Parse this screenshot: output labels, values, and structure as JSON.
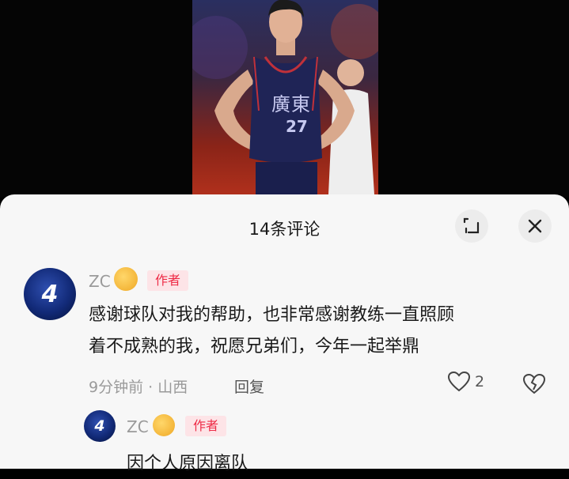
{
  "comments_panel": {
    "title": "14条评论",
    "expand_icon": "expand-icon",
    "close_icon": "close-icon"
  },
  "photo": {
    "jersey_text": "廣東",
    "jersey_number": "27"
  },
  "comments": [
    {
      "username": "ZC",
      "badge": "作者",
      "text_line1": "感谢球队对我的帮助，也非常感谢教练一直照顾",
      "text_line2": "着不成熟的我，祝愿兄弟们，今年一起举鼎",
      "time": "9分钟前",
      "location": "山西",
      "reply_label": "回复",
      "likes": "2",
      "avatar_text": "4"
    }
  ],
  "reply": {
    "username": "ZC",
    "badge": "作者",
    "text": "因个人原因离队",
    "avatar_text": "4"
  },
  "colors": {
    "badge_text": "#ee2b46",
    "badge_bg": "#fde4e7",
    "sheet_bg": "#f7f7f7"
  }
}
